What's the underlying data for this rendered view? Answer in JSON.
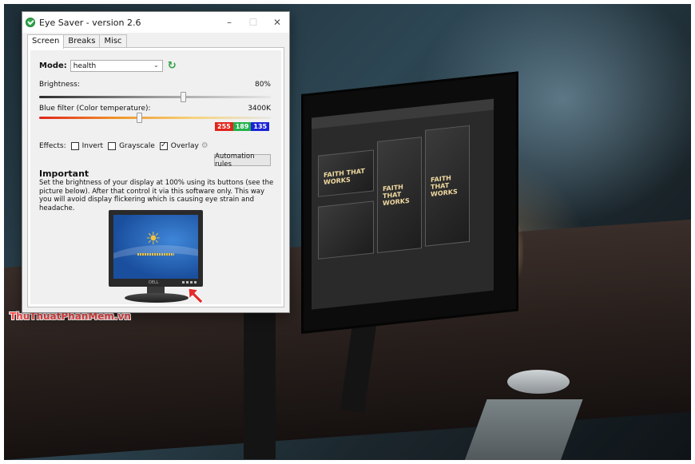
{
  "window": {
    "title": "Eye Saver - version 2.6",
    "minimize": "–",
    "maximize": "☐",
    "close": "✕"
  },
  "tabs": [
    {
      "label": "Screen",
      "active": true
    },
    {
      "label": "Breaks",
      "active": false
    },
    {
      "label": "Misc",
      "active": false
    }
  ],
  "mode": {
    "label": "Mode:",
    "value": "health",
    "chevron": "⌄",
    "refresh_icon": "↻"
  },
  "brightness": {
    "label": "Brightness:",
    "value_text": "80%",
    "value": 0.62
  },
  "blue_filter": {
    "label": "Blue filter (Color temperature):",
    "value_text": "3400K",
    "value": 0.43,
    "rgb": {
      "r": "255",
      "g": "189",
      "b": "135"
    }
  },
  "effects": {
    "label": "Effects:",
    "invert": {
      "label": "Invert",
      "checked": false
    },
    "grayscale": {
      "label": "Grayscale",
      "checked": false
    },
    "overlay": {
      "label": "Overlay",
      "checked": true
    },
    "gear_icon": "⚙"
  },
  "automation_button": "Automation rules",
  "important": {
    "title": "Important",
    "text": "Set the brightness of your display at 100% using its buttons (see the picture below). After that control it via this software only. This way you will avoid display flickering which is causing eye strain and headache."
  },
  "illustration": {
    "brand": "DELL"
  },
  "photo": {
    "slide_text": "FAITH THAT WORKS"
  },
  "watermark": "ThuThuatPhanMem.vn",
  "colors": {
    "r": "#e0241b",
    "g": "#22b14c",
    "b": "#1a23d6",
    "refresh": "#2ea043"
  }
}
